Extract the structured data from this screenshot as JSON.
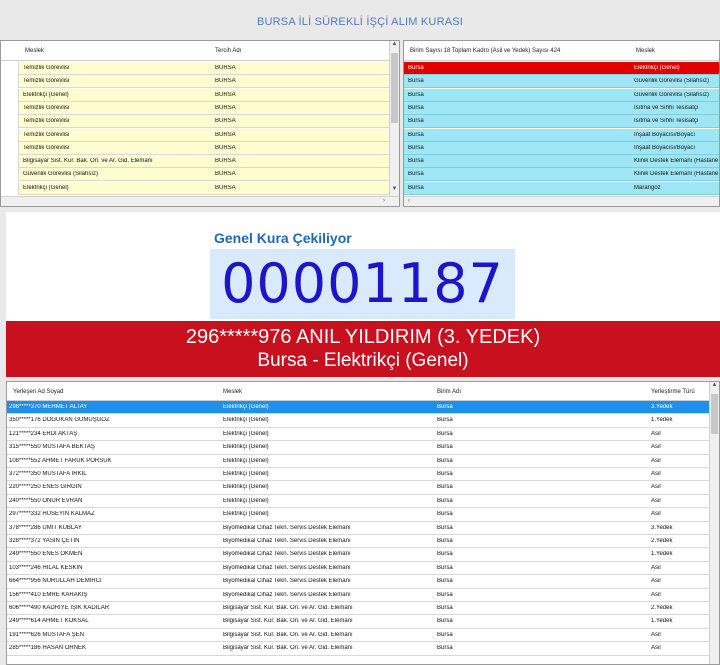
{
  "app": {
    "title": "BURSA İLİ SÜREKLİ İŞÇİ ALIM KURASI"
  },
  "preferences_grid": {
    "columns": [
      "Meslek",
      "Tercih Adı"
    ],
    "rows": [
      {
        "meslek": "Temizlik Görevlisi",
        "tercih": "BURSA"
      },
      {
        "meslek": "Temizlik Görevlisi",
        "tercih": "BURSA"
      },
      {
        "meslek": "Elektrikçi (Genel)",
        "tercih": "BURSA"
      },
      {
        "meslek": "Temizlik Görevlisi",
        "tercih": "BURSA"
      },
      {
        "meslek": "Temizlik Görevlisi",
        "tercih": "BURSA"
      },
      {
        "meslek": "Temizlik Görevlisi",
        "tercih": "BURSA"
      },
      {
        "meslek": "Temizlik Görevlisi",
        "tercih": "BURSA"
      },
      {
        "meslek": "Bilgisayar Sist. Kur. Bak. On. ve Ar. Gid. Elemanı",
        "tercih": "BURSA"
      },
      {
        "meslek": "Güvenlik Görevlisi (Silahsız)",
        "tercih": "BURSA"
      },
      {
        "meslek": "Elektrikçi (Genel)",
        "tercih": "BURSA"
      }
    ]
  },
  "units_grid": {
    "columns": [
      "Birim Sayısı 18 Toplam Kadro (Asil ve Yedek) Sayısı 424",
      "Meslek"
    ],
    "rows": [
      {
        "birim": "Bursa",
        "meslek": "Elektrikçi (Genel)"
      },
      {
        "birim": "Bursa",
        "meslek": "Güvenlik Görevlisi (Silahsız)"
      },
      {
        "birim": "Bursa",
        "meslek": "Güvenlik Görevlisi (Silahsız)"
      },
      {
        "birim": "Bursa",
        "meslek": "Isıtma ve Sıhhi Tesisatçı"
      },
      {
        "birim": "Bursa",
        "meslek": "Isıtma ve Sıhhi Tesisatçı"
      },
      {
        "birim": "Bursa",
        "meslek": "İnşaat Boyacısı/Boyacı"
      },
      {
        "birim": "Bursa",
        "meslek": "İnşaat Boyacısı/Boyacı"
      },
      {
        "birim": "Bursa",
        "meslek": "Klinik Destek Elemanı (Hastane"
      },
      {
        "birim": "Bursa",
        "meslek": "Klinik Destek Elemanı (Hastane"
      },
      {
        "birim": "Bursa",
        "meslek": "Marangoz"
      }
    ]
  },
  "draw": {
    "label": "Genel Kura Çekiliyor",
    "number": "00001187",
    "winner_line1": "296*****976 ANIL YILDIRIM (3. YEDEK)",
    "winner_line2": "Bursa - Elektrikçi (Genel)"
  },
  "placements_grid": {
    "columns": [
      "Yerleşen Ad Soyad",
      "Meslek",
      "Birim Adı",
      "Yerleştirme Türü"
    ],
    "rows": [
      {
        "ad": "298*****370 MEHMET ALTAY",
        "meslek": "Elektrikçi (Genel)",
        "birim": "Bursa",
        "tur": "3.Yedek"
      },
      {
        "ad": "350*****176 DOĞUKAN GÜMÜŞGÖZ",
        "meslek": "Elektrikçi (Genel)",
        "birim": "Bursa",
        "tur": "1.Yedek"
      },
      {
        "ad": "121*****234 ERDİ AKTAŞ",
        "meslek": "Elektrikçi (Genel)",
        "birim": "Bursa",
        "tur": "Asil"
      },
      {
        "ad": "315*****550 MUSTAFA BEKTAŞ",
        "meslek": "Elektrikçi (Genel)",
        "birim": "Bursa",
        "tur": "Asil"
      },
      {
        "ad": "108*****552 AHMET FARUK PORSUK",
        "meslek": "Elektrikçi (Genel)",
        "birim": "Bursa",
        "tur": "Asil"
      },
      {
        "ad": "372*****350 MUSTAFA IRKIL",
        "meslek": "Elektrikçi (Genel)",
        "birim": "Bursa",
        "tur": "Asil"
      },
      {
        "ad": "220*****250 ENES GİRGİN",
        "meslek": "Elektrikçi (Genel)",
        "birim": "Bursa",
        "tur": "Asil"
      },
      {
        "ad": "240*****550 ONUR EVRAN",
        "meslek": "Elektrikçi (Genel)",
        "birim": "Bursa",
        "tur": "Asil"
      },
      {
        "ad": "297*****332 HÜSEYİN KALMAZ",
        "meslek": "Elektrikçi (Genel)",
        "birim": "Bursa",
        "tur": "Asil"
      },
      {
        "ad": "378*****286 ÜMİT KUBLAY",
        "meslek": "Biyomedikal Cihaz Tekn. Servis Destek Elemanı",
        "birim": "Bursa",
        "tur": "3.Yedek"
      },
      {
        "ad": "328*****372 YASİN ÇETİN",
        "meslek": "Biyomedikal Cihaz Tekn. Servis Destek Elemanı",
        "birim": "Bursa",
        "tur": "2.Yedek"
      },
      {
        "ad": "249*****550 ENES ÖKMEN",
        "meslek": "Biyomedikal Cihaz Tekn. Servis Destek Elemanı",
        "birim": "Bursa",
        "tur": "1.Yedek"
      },
      {
        "ad": "103*****246 HİLAL KESKİN",
        "meslek": "Biyomedikal Cihaz Tekn. Servis Destek Elemanı",
        "birim": "Bursa",
        "tur": "Asil"
      },
      {
        "ad": "664*****956 NURULLAH DEMİRCİ",
        "meslek": "Biyomedikal Cihaz Tekn. Servis Destek Elemanı",
        "birim": "Bursa",
        "tur": "Asil"
      },
      {
        "ad": "156*****410 EMRE KARAKIŞ",
        "meslek": "Biyomedikal Cihaz Tekn. Servis Destek Elemanı",
        "birim": "Bursa",
        "tur": "Asil"
      },
      {
        "ad": "606*****490 KADRİYE IŞIK KADILAR",
        "meslek": "Bilgisayar Sist. Kur. Bak. On. ve Ar. Gid. Elemanı",
        "birim": "Bursa",
        "tur": "2.Yedek"
      },
      {
        "ad": "249*****614 AHMET KÖKSAL",
        "meslek": "Bilgisayar Sist. Kur. Bak. On. ve Ar. Gid. Elemanı",
        "birim": "Bursa",
        "tur": "1.Yedek"
      },
      {
        "ad": "191*****626 MUSTAFA ŞEN",
        "meslek": "Bilgisayar Sist. Kur. Bak. On. ve Ar. Gid. Elemanı",
        "birim": "Bursa",
        "tur": "Asil"
      },
      {
        "ad": "285*****186 HASAN ÖRNEK",
        "meslek": "Bilgisayar Sist. Kur. Bak. On. ve Ar. Gid. Elemanı",
        "birim": "Bursa",
        "tur": "Asil"
      }
    ]
  },
  "colors": {
    "title": "#4b7bc6",
    "pref_row": "#fffdd0",
    "unit_row": "#9fe6f4",
    "unit_selected": "#e00000",
    "draw_label": "#1f69b6",
    "draw_number": "#1d16c8",
    "banner": "#c8101e",
    "placement_selected": "#1e90ea"
  },
  "icons": [
    "scroll-up-arrow-icon",
    "scroll-down-arrow-icon",
    "scroll-left-arrow-icon",
    "scroll-right-arrow-icon"
  ]
}
